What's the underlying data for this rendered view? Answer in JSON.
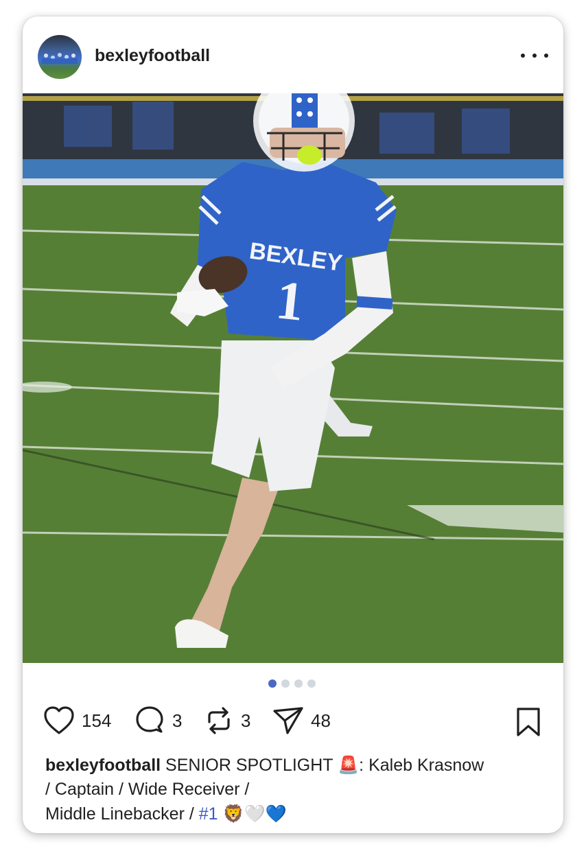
{
  "post": {
    "username": "bexleyfootball",
    "likes": "154",
    "comments": "3",
    "reposts": "3",
    "shares": "48",
    "carousel": {
      "total": 4,
      "active": 0
    },
    "caption": {
      "username": "bexleyfootball",
      "line1": "SENIOR SPOTLIGHT",
      "siren_emoji": "🚨",
      "line1_rest": ": Kaleb Krasnow",
      "line2": "/ Captain / Wide Receiver /",
      "line3": "Middle Linebacker / ",
      "hashtag": "#1",
      "emojis": "🦁🤍💙"
    }
  },
  "photo": {
    "jersey_text": "BEXLEY",
    "jersey_number": "1"
  },
  "icons": {
    "more": "more-horizontal-icon",
    "like": "heart-icon",
    "comment": "comment-bubble-icon",
    "repost": "repost-icon",
    "share": "send-icon",
    "save": "bookmark-icon"
  },
  "colors": {
    "accent": "#3b5bc4",
    "dot_active": "#4a69c3",
    "dot_inactive": "#d3d7de",
    "jersey_blue": "#2f63c8",
    "turf_green": "#567f36"
  }
}
